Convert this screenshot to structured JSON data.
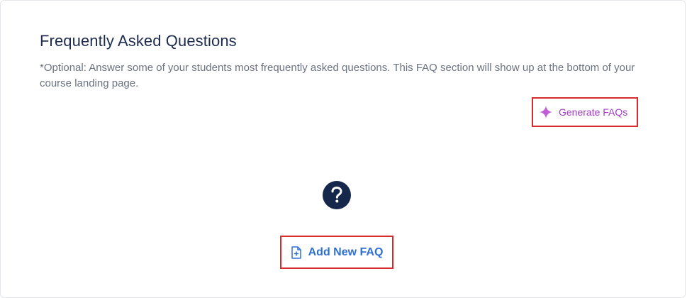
{
  "faq_section": {
    "title": "Frequently Asked Questions",
    "description": "*Optional: Answer some of your students most frequently asked questions. This FAQ section will show up at the bottom of your course landing page.",
    "generate_button": {
      "label": "Generate FAQs",
      "icon": "sparkle-icon",
      "color": "#a43cc4"
    },
    "empty_state_icon": "question-circle-icon",
    "add_button": {
      "label": "Add New FAQ",
      "icon": "add-document-icon",
      "color": "#2f6fd6"
    }
  },
  "colors": {
    "title": "#1d2b4f",
    "description": "#6b7280",
    "highlight_border": "#d92b2b",
    "question_circle": "#15284b"
  }
}
